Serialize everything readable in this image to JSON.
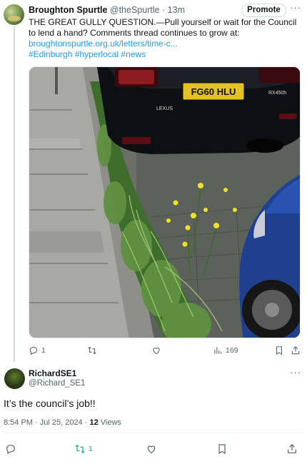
{
  "tweet": {
    "author_name": "Broughton Spurtle",
    "author_handle": "@theSpurtle",
    "time": "· 13m",
    "promote_label": "Promote",
    "more_label": "···",
    "text": "THE GREAT GULLY QUESTION.—Pull yourself or wait for the Council to lend a hand? Comments thread continues to grow at:",
    "link": "broughtonspurtle.org.uk/letters/time-c...",
    "hashtags": "#Edinburgh #hyperlocal #news",
    "plate": "FG60 HLU",
    "badge": "LEXUS",
    "model": "RX450h",
    "stats": {
      "replies": "1",
      "views": "169"
    }
  },
  "reply": {
    "author_name": "RichardSE1",
    "author_handle": "@Richard_SE1",
    "more_label": "···",
    "text": "It’s the council’s job!!",
    "timestamp": "8:54 PM · Jul 25, 2024 ·",
    "views_count": "12",
    "views_label": "Views",
    "stats": {
      "retweets": "1"
    }
  },
  "colors": {
    "accent": "#1d9bf0",
    "retweet_active": "#00ba7c",
    "muted": "#536471"
  }
}
